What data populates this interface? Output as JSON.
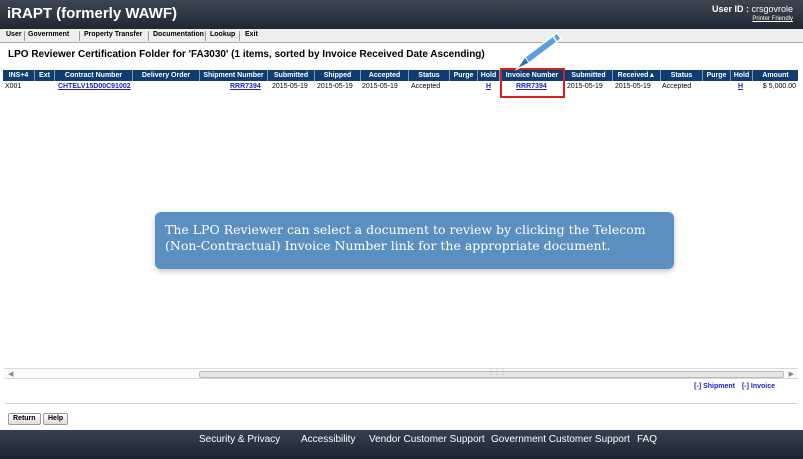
{
  "header": {
    "brand": "iRAPT (formerly WAWF)",
    "user_label": "User ID :",
    "user_value": "crsgovrole",
    "printer_link": "Printer Friendly"
  },
  "menu": [
    "User",
    "Government",
    "Property Transfer",
    "Documentation",
    "Lookup",
    "Exit"
  ],
  "page_title": "LPO Reviewer Certification Folder for 'FA3030' (1 items, sorted by Invoice Received Date Ascending)",
  "table": {
    "columns": [
      "INS+4",
      "Ext",
      "Contract Number",
      "Delivery Order",
      "Shipment Number",
      "Submitted",
      "Shipped",
      "Accepted",
      "Status",
      "Purge",
      "Hold",
      "Invoice Number",
      "Submitted",
      "Received▲",
      "Status",
      "Purge",
      "Hold",
      "Amount"
    ],
    "rows": [
      [
        "X001",
        "",
        "CHTELV15D00C91002",
        "",
        "RRR7394",
        "2015-05-19",
        "2015-05-19",
        "2015-05-19",
        "Accepted",
        "",
        "H",
        "RRR7394",
        "2015-05-19",
        "2015-05-19",
        "Accepted",
        "",
        "H",
        "$ 5,000.00"
      ]
    ]
  },
  "callout_text": "The LPO Reviewer can select a document to review by clicking the Telecom (Non-Contractual) Invoice Number link for the appropriate document.",
  "toggle_links": [
    "[-] Shipment",
    "[-] Invoice"
  ],
  "buttons": {
    "return": "Return",
    "help": "Help"
  },
  "footer": [
    "Security & Privacy",
    "Accessibility",
    "Vendor Customer Support",
    "Government Customer Support",
    "FAQ"
  ],
  "colors": {
    "header_bg": "#1f2731",
    "table_header_bg": "#0f3c71",
    "link": "#1b24b8",
    "highlight": "#d71f1f",
    "callout_bg": "#5b8fc0"
  },
  "icons": {
    "pencil": "pencil-icon"
  }
}
